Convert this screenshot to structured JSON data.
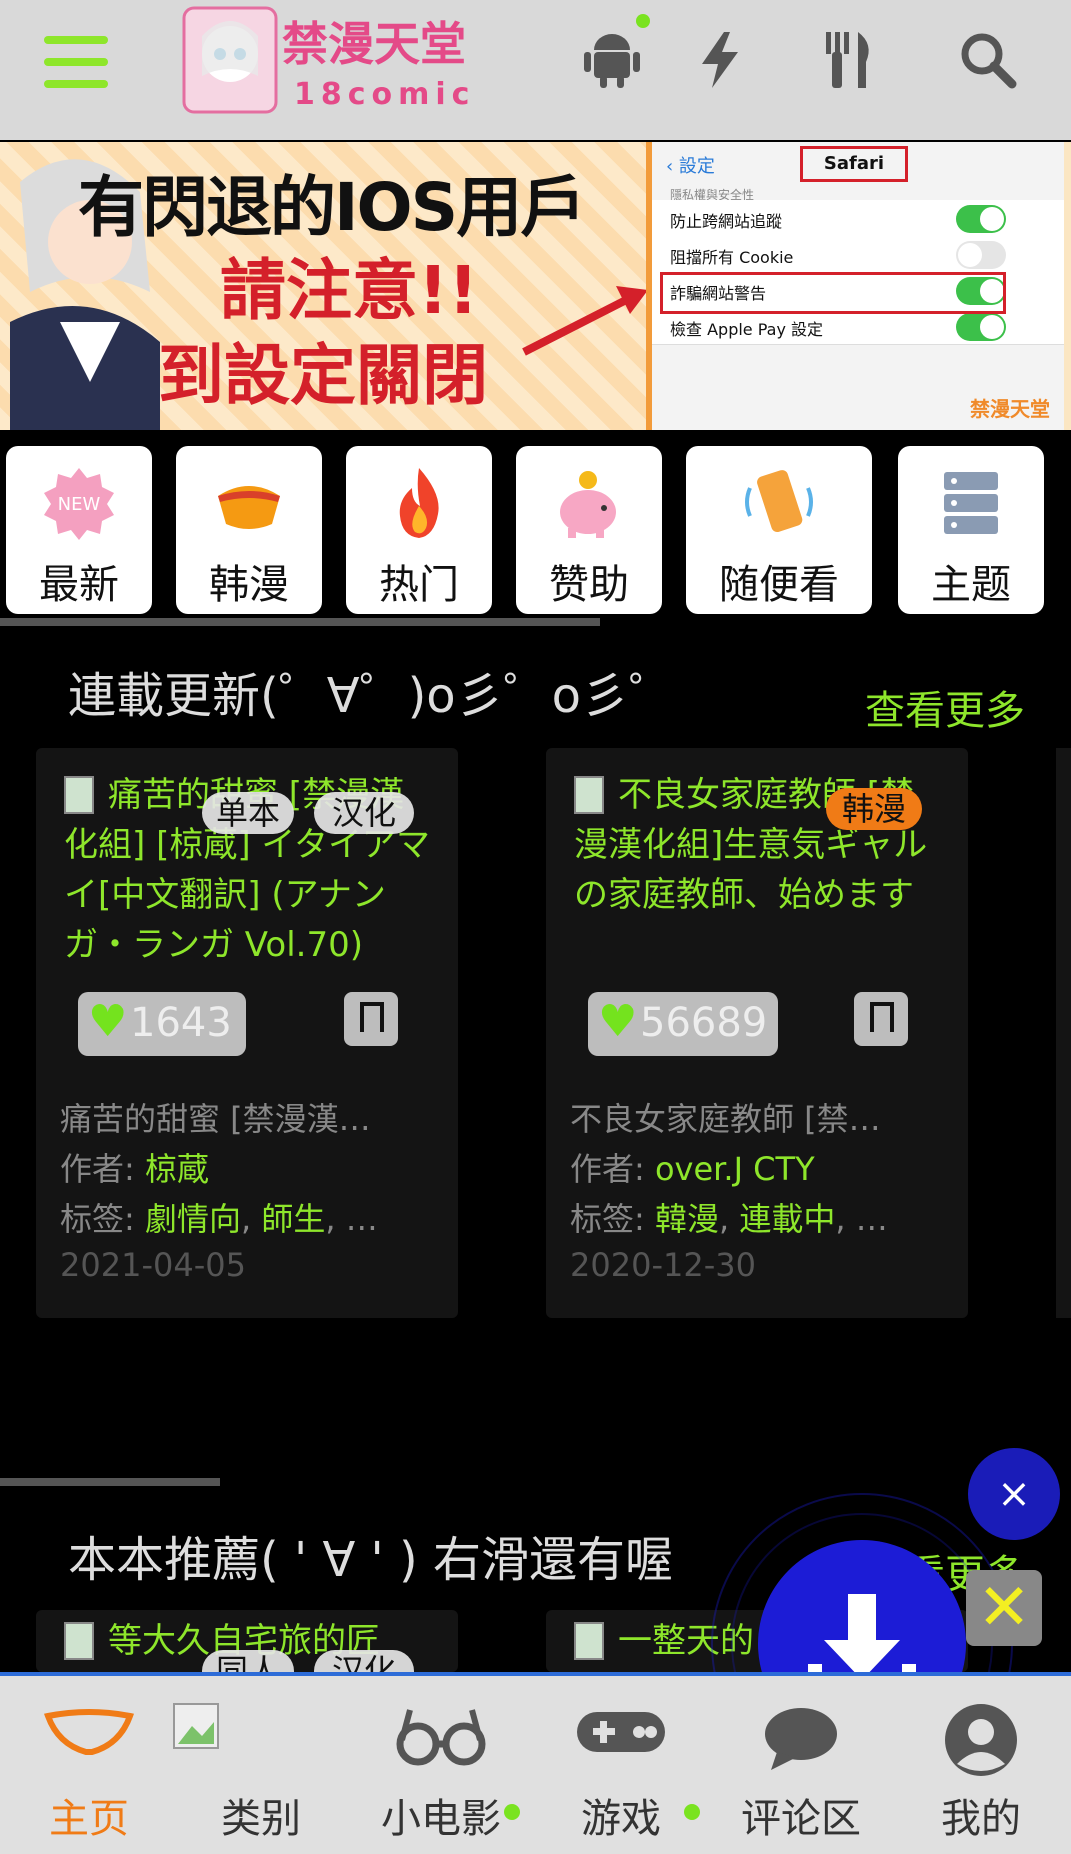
{
  "header": {
    "logo_text": "禁漫天堂",
    "logo_sub": "18comic"
  },
  "banner": {
    "line1": "有閃退的IOS用戶",
    "line2": "請注意!!",
    "line3": "到設定關閉",
    "phone_back": "設定",
    "phone_title": "Safari",
    "phone_subheading": "隱私權與安全性",
    "rows": [
      {
        "label": "防止跨網站追蹤",
        "on": true
      },
      {
        "label": "阻擋所有 Cookie",
        "on": false
      },
      {
        "label": "詐騙網站警告",
        "on": true
      },
      {
        "label": "檢查 Apple Pay 設定",
        "on": true
      }
    ],
    "brand": "禁漫天堂"
  },
  "categories": [
    "最新",
    "韩漫",
    "热门",
    "赞助",
    "随便看",
    "主题"
  ],
  "section1": {
    "title": "連載更新(゜∀゜)o彡゜o彡゜",
    "more": "查看更多",
    "cards": [
      {
        "title": "痛苦的甜蜜 [禁漫漢化組] [椋蔵] イタイアマイ[中文翻訳] (アナンガ・ランガ Vol.70)",
        "pills": [
          "单本",
          "汉化"
        ],
        "likes": "1643",
        "short_title": "痛苦的甜蜜 [禁漫漢…",
        "author_label": "作者: ",
        "author": "椋蔵",
        "tags_label": "标签: ",
        "tag1": "劇情向",
        "tag2": "師生",
        "tag_sep": ", ",
        "tag_more": ", …",
        "date": "2021-04-05"
      },
      {
        "title": "不良女家庭教師 [禁漫漢化組]生意気ギャルの家庭教師、始めます",
        "pills": [
          "韩漫"
        ],
        "likes": "56689",
        "short_title": "不良女家庭教師 [禁…",
        "author_label": "作者: ",
        "author": "over.J CTY",
        "tags_label": "标签: ",
        "tag1": "韓漫",
        "tag2": "連載中",
        "tag_sep": ", ",
        "tag_more": ", …",
        "date": "2020-12-30"
      }
    ]
  },
  "section2": {
    "title": "本本推薦( ' ∀ ' ) 右滑還有喔",
    "more": "查看更多",
    "card1_title": "等大久自宅旅的匠",
    "card1_pills": [
      "同人",
      "汉化"
    ],
    "card2_title": "一整天的"
  },
  "fab": {
    "close": "×",
    "dismiss": "✕"
  },
  "nav": {
    "items": [
      {
        "label": "主页",
        "active": true
      },
      {
        "label": "类别"
      },
      {
        "label": "小电影"
      },
      {
        "label": "游戏"
      },
      {
        "label": "评论区"
      },
      {
        "label": "我的"
      }
    ]
  },
  "colors": {
    "accent_green": "#8ee62b",
    "active_orange": "#f07b16",
    "fab_blue": "#1c1cd6"
  }
}
